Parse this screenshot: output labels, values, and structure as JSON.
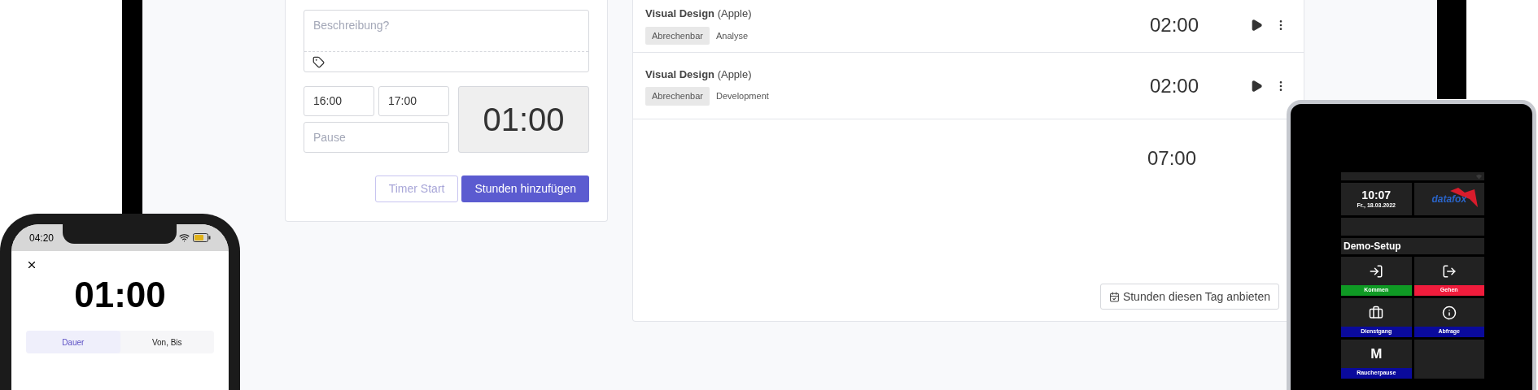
{
  "form": {
    "description": {
      "placeholder": "Beschreibung?"
    },
    "start": "16:00",
    "end": "17:00",
    "pause": {
      "placeholder": "Pause"
    },
    "duration": "01:00",
    "buttons": [
      {
        "label": "Timer Start",
        "kind": "outline"
      },
      {
        "label": "Stunden hinzufügen",
        "kind": "primary"
      }
    ]
  },
  "entries": [
    {
      "title": "**Visual Design** (Apple)",
      "tags": [
        {
          "label": "Abrechenbar",
          "kind": "badge"
        },
        {
          "label": "Analyse",
          "kind": "plain"
        }
      ],
      "duration": "02:00"
    },
    {
      "title": "**Visual Design** (Apple)",
      "tags": [
        {
          "label": "Abrechenbar",
          "kind": "badge"
        },
        {
          "label": "Development",
          "kind": "plain"
        }
      ],
      "duration": "02:00"
    }
  ],
  "total": "07:00",
  "offer_button": "Stunden diesen Tag anbieten",
  "phone": {
    "clock": "04:20",
    "timer": "01:00",
    "tabs": [
      {
        "label": "Dauer",
        "selected": true
      },
      {
        "label": "Von, Bis",
        "selected": false
      }
    ]
  },
  "terminal": {
    "time": "10:07",
    "date": "Fr., 18.03.2022",
    "logo": "datafox",
    "title": "Demo-Setup",
    "tiles": [
      {
        "label": "Kommen",
        "color": "#0f9a24",
        "kind": "enter"
      },
      {
        "label": "Gehen",
        "color": "#f01c3c",
        "kind": "exit"
      },
      {
        "label": "Dienstgang",
        "color": "#0a0a9c",
        "kind": "case"
      },
      {
        "label": "Abfrage",
        "color": "#0a0a9c",
        "kind": "info"
      },
      {
        "label": "Raucherpause",
        "color": "#0a0a9c",
        "kind": "letter",
        "glyph": "M"
      }
    ]
  }
}
